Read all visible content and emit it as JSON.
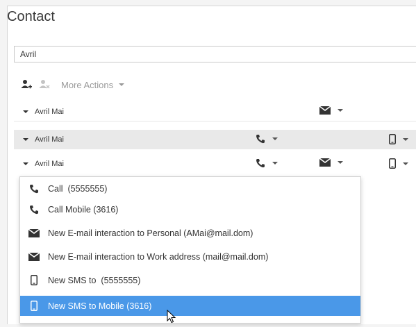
{
  "contact": {
    "title": "Contact",
    "search_value": "Avril",
    "toolbar": {
      "add_contact_icon": "add-contact-icon",
      "remove_contact_icon": "remove-contact-icon",
      "more_actions_label": "More Actions"
    },
    "rows": [
      {
        "name": "Avril Mai",
        "channels": [
          "email"
        ]
      },
      {
        "name": "Avril Mai",
        "channels": [
          "phone",
          "mobile"
        ]
      },
      {
        "name": "Avril Mai",
        "channels": [
          "phone",
          "email",
          "mobile"
        ]
      }
    ]
  },
  "menu": {
    "items": [
      {
        "icon": "phone-icon",
        "label": "Call  (5555555)"
      },
      {
        "icon": "phone-icon",
        "label": "Call Mobile (3616)"
      },
      {
        "icon": "envelope-icon",
        "label": "New E-mail interaction to Personal (AMai@mail.dom)"
      },
      {
        "icon": "envelope-icon",
        "label": "New E-mail interaction to Work address (mail@mail.dom)"
      },
      {
        "icon": "mobile-icon",
        "label": "New SMS to  (5555555)"
      },
      {
        "icon": "mobile-icon",
        "label": "New SMS to Mobile (3616)",
        "selected": true
      }
    ]
  },
  "colors": {
    "selection": "#4a98e8",
    "row_alt": "#e9e9e9"
  }
}
